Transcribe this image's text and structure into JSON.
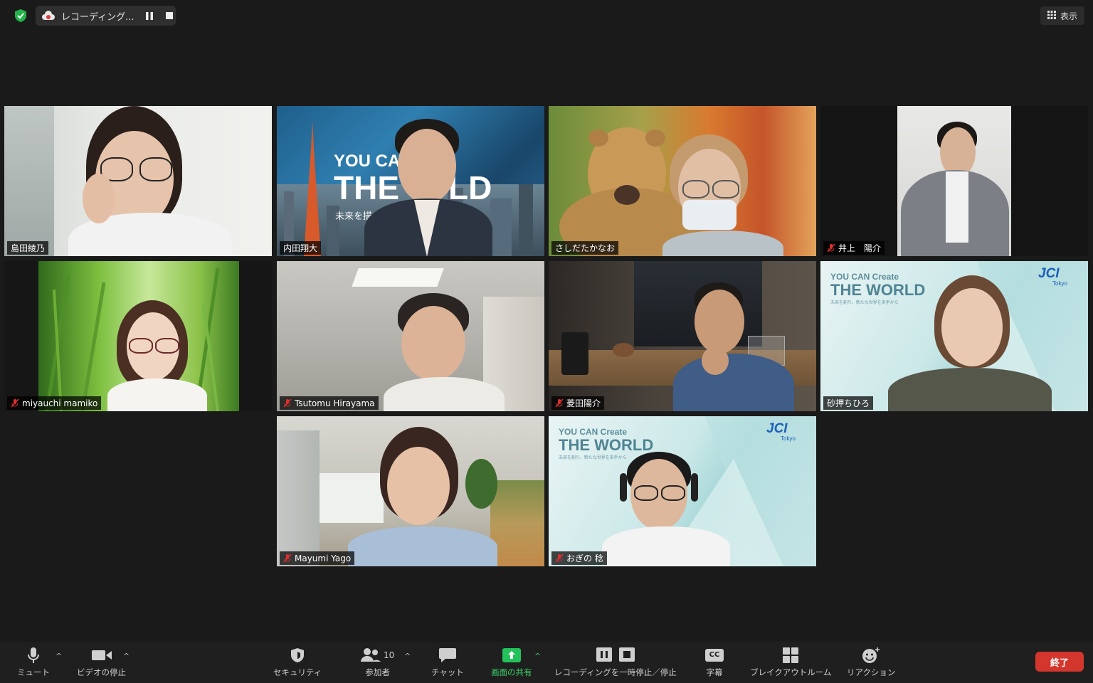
{
  "top_bar": {
    "recording_label": "レコーディング...",
    "view_label": "表示"
  },
  "participants": [
    {
      "name": "島田綾乃",
      "muted": false,
      "active_speaker": true
    },
    {
      "name": "内田翔大",
      "muted": false,
      "background_text_1": "YOU CAN",
      "background_text_2": "THE W  LD",
      "background_text_3": "未来を描"
    },
    {
      "name": "さしだたかなお",
      "muted": false
    },
    {
      "name": "井上　陽介",
      "muted": true
    },
    {
      "name": "miyauchi mamiko",
      "muted": true
    },
    {
      "name": "Tsutomu Hirayama",
      "muted": true
    },
    {
      "name": "菱田陽介",
      "muted": true
    },
    {
      "name": "砂押ちひろ",
      "muted": false,
      "background_text_1": "YOU CAN Create",
      "background_text_2": "THE WORLD",
      "background_text_3": "未来を創り、新たな世界を来手から",
      "logo": "JCI",
      "logo_sub": "Tokyo"
    },
    {
      "name": "Mayumi Yago",
      "muted": true
    },
    {
      "name": "おぎの 稔",
      "muted": true,
      "background_text_1": "YOU CAN Create",
      "background_text_2": "THE WORLD",
      "background_text_3": "未来を創り、新たな世界を来手から",
      "logo": "JCI",
      "logo_sub": "Tokyo"
    }
  ],
  "toolbar": {
    "mute": "ミュート",
    "stop_video": "ビデオの停止",
    "security": "セキュリティ",
    "participants": "参加者",
    "participants_count": "10",
    "chat": "チャット",
    "share_screen": "画面の共有",
    "recording_control": "レコーディングを一時停止／停止",
    "captions": "字幕",
    "captions_icon_text": "CC",
    "breakout_rooms": "ブレイクアウトルーム",
    "reactions": "リアクション",
    "end": "終了"
  },
  "colors": {
    "active_speaker_border": "#e9ec8d",
    "share_green": "#23c25b",
    "end_red": "#d3362d",
    "muted_red": "#e02f2f"
  }
}
